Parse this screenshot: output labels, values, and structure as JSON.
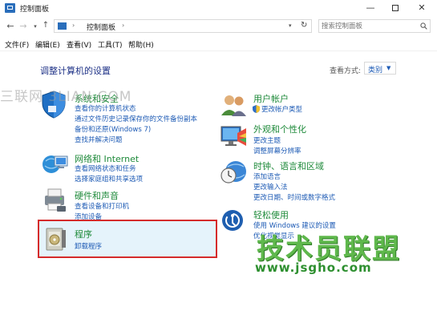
{
  "window": {
    "title": "控制面板",
    "min": "—",
    "close": "✕"
  },
  "address": {
    "separator": "›",
    "breadcrumb": "控制面板",
    "crumb_separator": "›",
    "search_placeholder": "搜索控制面板"
  },
  "menu": [
    "文件(F)",
    "编辑(E)",
    "查看(V)",
    "工具(T)",
    "帮助(H)"
  ],
  "main": {
    "heading": "调整计算机的设置",
    "view_label": "查看方式:",
    "view_value": "类别"
  },
  "categories_left": [
    {
      "title": "系统和安全",
      "links": [
        "查看你的计算机状态",
        "通过文件历史记录保存你的文件备份副本",
        "备份和还原(Windows 7)",
        "查找并解决问题"
      ]
    },
    {
      "title": "网络和 Internet",
      "links": [
        "查看网络状态和任务",
        "选择家庭组和共享选项"
      ]
    },
    {
      "title": "硬件和声音",
      "links": [
        "查看设备和打印机",
        "添加设备"
      ]
    },
    {
      "title": "程序",
      "links": [
        "卸载程序"
      ]
    }
  ],
  "categories_right": [
    {
      "title": "用户帐户",
      "links": [
        "更改帐户类型"
      ]
    },
    {
      "title": "外观和个性化",
      "links": [
        "更改主题",
        "调整屏幕分辨率"
      ]
    },
    {
      "title": "时钟、语言和区域",
      "links": [
        "添加语言",
        "更改输入法",
        "更改日期、时间或数字格式"
      ]
    },
    {
      "title": "轻松使用",
      "links": [
        "使用 Windows 建议的设置",
        "优化视觉显示"
      ]
    }
  ],
  "watermarks": {
    "site1": "三联网 3LIAN.COM",
    "brand": "技术员联盟",
    "url": "www.jsgho.com"
  }
}
